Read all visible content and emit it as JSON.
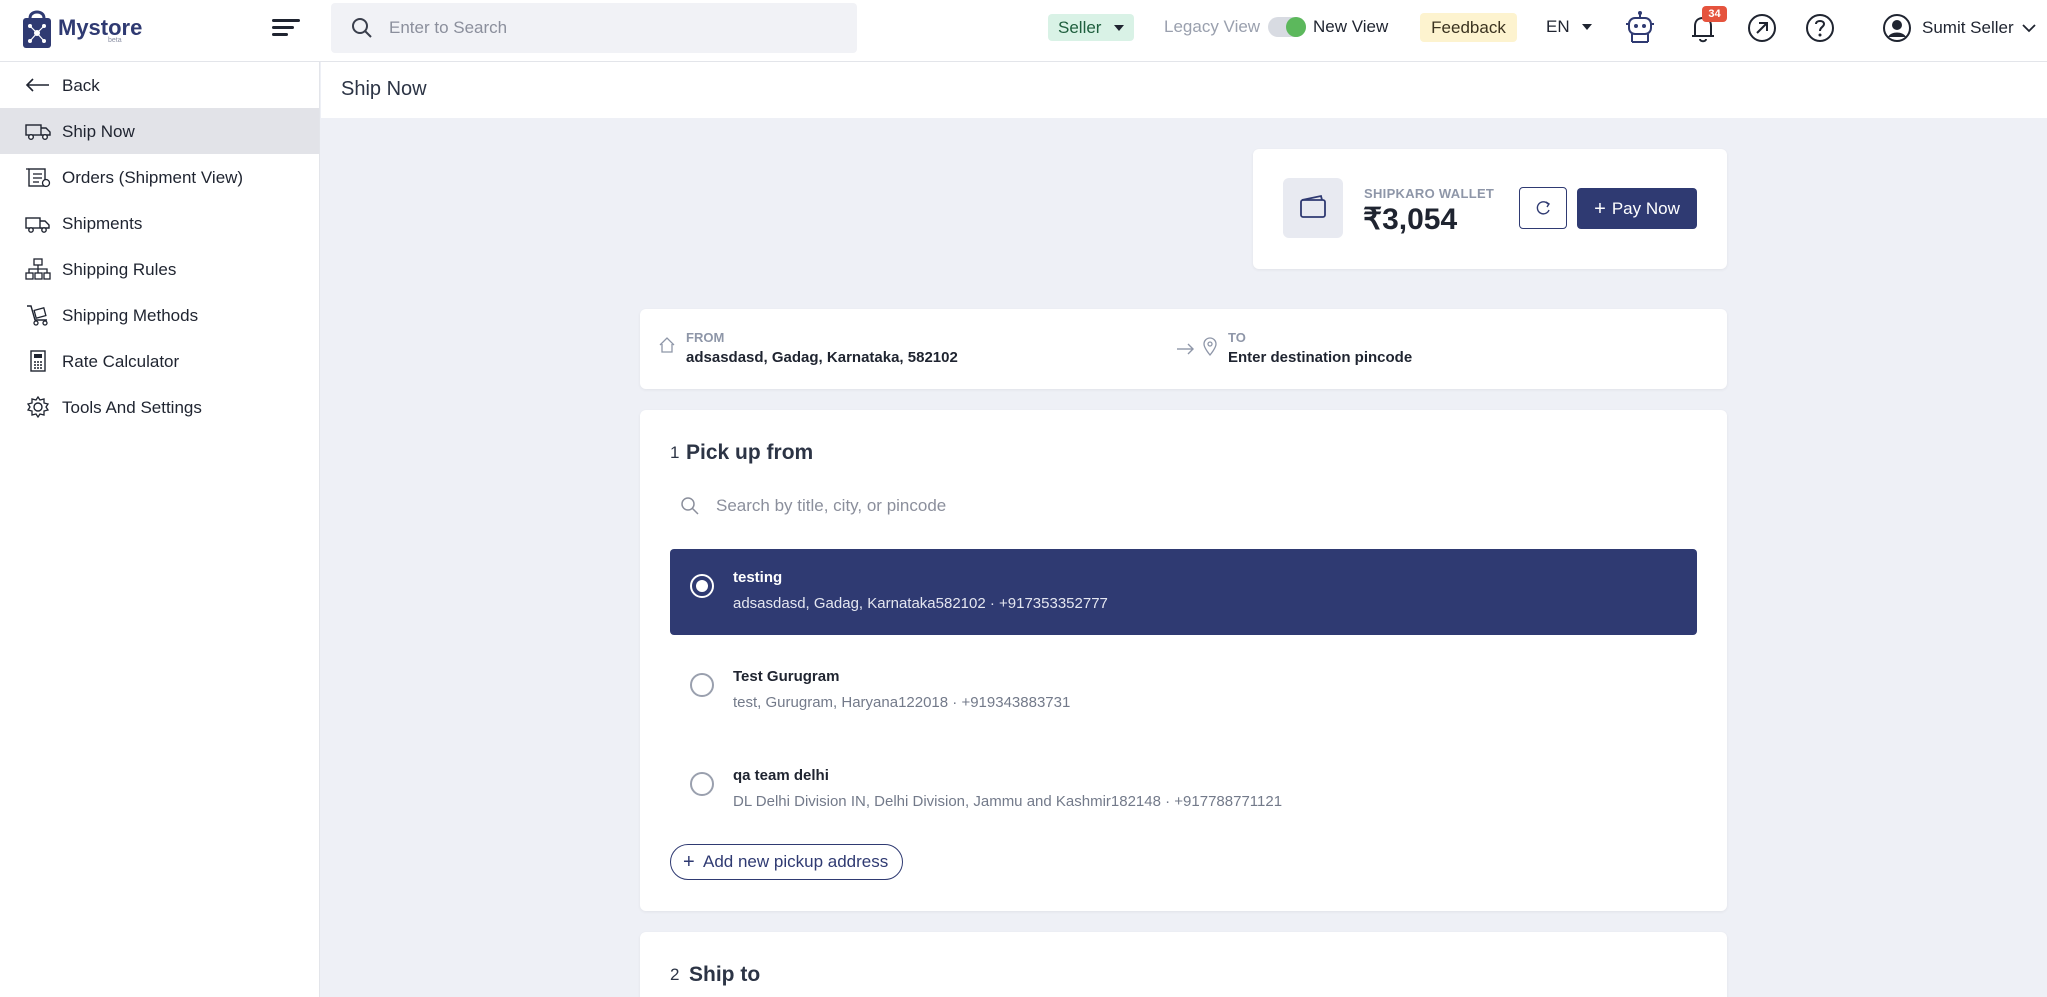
{
  "app": {
    "logo_text": "Mystore",
    "logo_sub": "beta"
  },
  "topbar": {
    "search_placeholder": "Enter to Search",
    "role_label": "Seller",
    "legacy_view_label": "Legacy View",
    "new_view_label": "New View",
    "feedback_label": "Feedback",
    "language": "EN",
    "notification_count": "34",
    "user_name": "Sumit Seller"
  },
  "sidebar": {
    "back_label": "Back",
    "items": [
      {
        "label": "Ship Now",
        "icon": "truck-icon",
        "active": true
      },
      {
        "label": "Orders (Shipment View)",
        "icon": "orders-icon"
      },
      {
        "label": "Shipments",
        "icon": "shipment-truck-icon"
      },
      {
        "label": "Shipping Rules",
        "icon": "hierarchy-icon"
      },
      {
        "label": "Shipping Methods",
        "icon": "trolley-icon"
      },
      {
        "label": "Rate Calculator",
        "icon": "calculator-icon"
      },
      {
        "label": "Tools And Settings",
        "icon": "gear-icon"
      }
    ]
  },
  "page": {
    "title": "Ship Now"
  },
  "wallet": {
    "label": "SHIPKARO WALLET",
    "amount": "₹3,054",
    "pay_now_label": "Pay Now"
  },
  "route": {
    "from_label": "FROM",
    "from_value": "adsasdasd, Gadag, Karnataka, 582102",
    "to_label": "TO",
    "to_value": "Enter destination pincode"
  },
  "pickup": {
    "step_number": "1",
    "title": "Pick up from",
    "search_placeholder": "Search by title, city, or pincode",
    "addresses": [
      {
        "name": "testing",
        "detail": "adsasdasd, Gadag, Karnataka582102 · +917353352777",
        "selected": true
      },
      {
        "name": "Test Gurugram",
        "detail": "test, Gurugram, Haryana122018 · +919343883731",
        "selected": false
      },
      {
        "name": "qa team delhi",
        "detail": "DL Delhi Division IN, Delhi Division, Jammu and Kashmir182148 · +917788771121",
        "selected": false
      }
    ],
    "add_label": "Add new pickup address"
  },
  "shipto": {
    "step_number": "2",
    "title": "Ship to"
  },
  "colors": {
    "brand": "#2f3a72",
    "page_bg": "#eef0f6",
    "seller_pill_bg": "#d9f2e6",
    "feedback_bg": "#fdf3cf",
    "badge": "#e5533d",
    "toggle_on": "#5cb85c"
  }
}
